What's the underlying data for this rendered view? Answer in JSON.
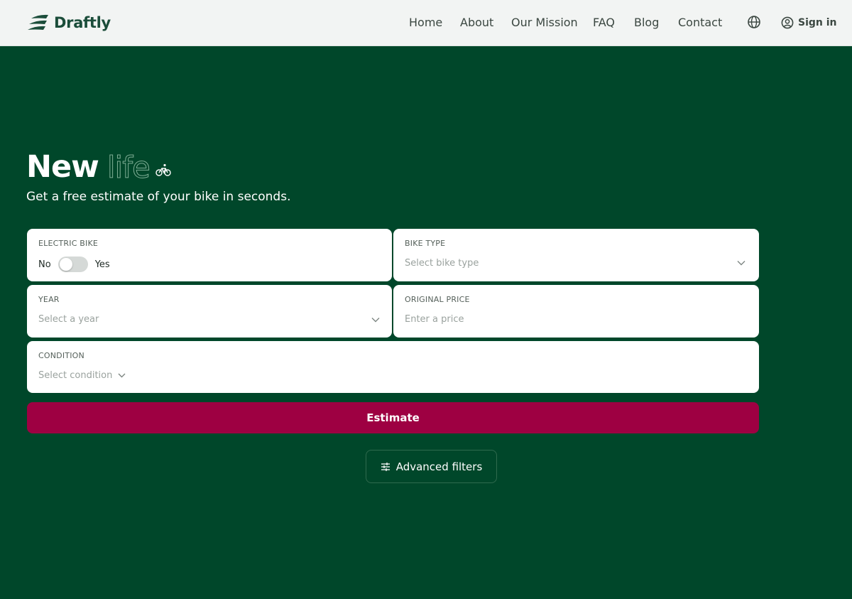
{
  "brand": {
    "name": "Draftly"
  },
  "nav": {
    "items": [
      "Home",
      "About",
      "Our Mission",
      "FAQ",
      "Blog",
      "Contact"
    ],
    "language_icon": "globe-icon",
    "sign_in_label": "Sign in",
    "sign_in_icon": "user-circle-icon"
  },
  "hero": {
    "title_strong": "New",
    "title_outline": "life",
    "subtitle": "Get a free estimate of your bike in seconds."
  },
  "form": {
    "electric": {
      "label": "ELECTRIC BIKE",
      "no": "No",
      "yes": "Yes",
      "value": "No"
    },
    "bike_type": {
      "label": "BIKE TYPE",
      "placeholder": "Select bike type"
    },
    "year": {
      "label": "YEAR",
      "placeholder": "Select a year"
    },
    "original_price": {
      "label": "ORIGINAL PRICE",
      "placeholder": "Enter a price"
    },
    "condition": {
      "label": "CONDITION",
      "placeholder": "Select condition"
    }
  },
  "actions": {
    "estimate_label": "Estimate",
    "advanced_filters_label": "Advanced filters"
  },
  "colors": {
    "background": "#00472a",
    "header": "#f2f4f3",
    "estimate_button": "#9e0042",
    "brand": "#1b4d3a"
  }
}
